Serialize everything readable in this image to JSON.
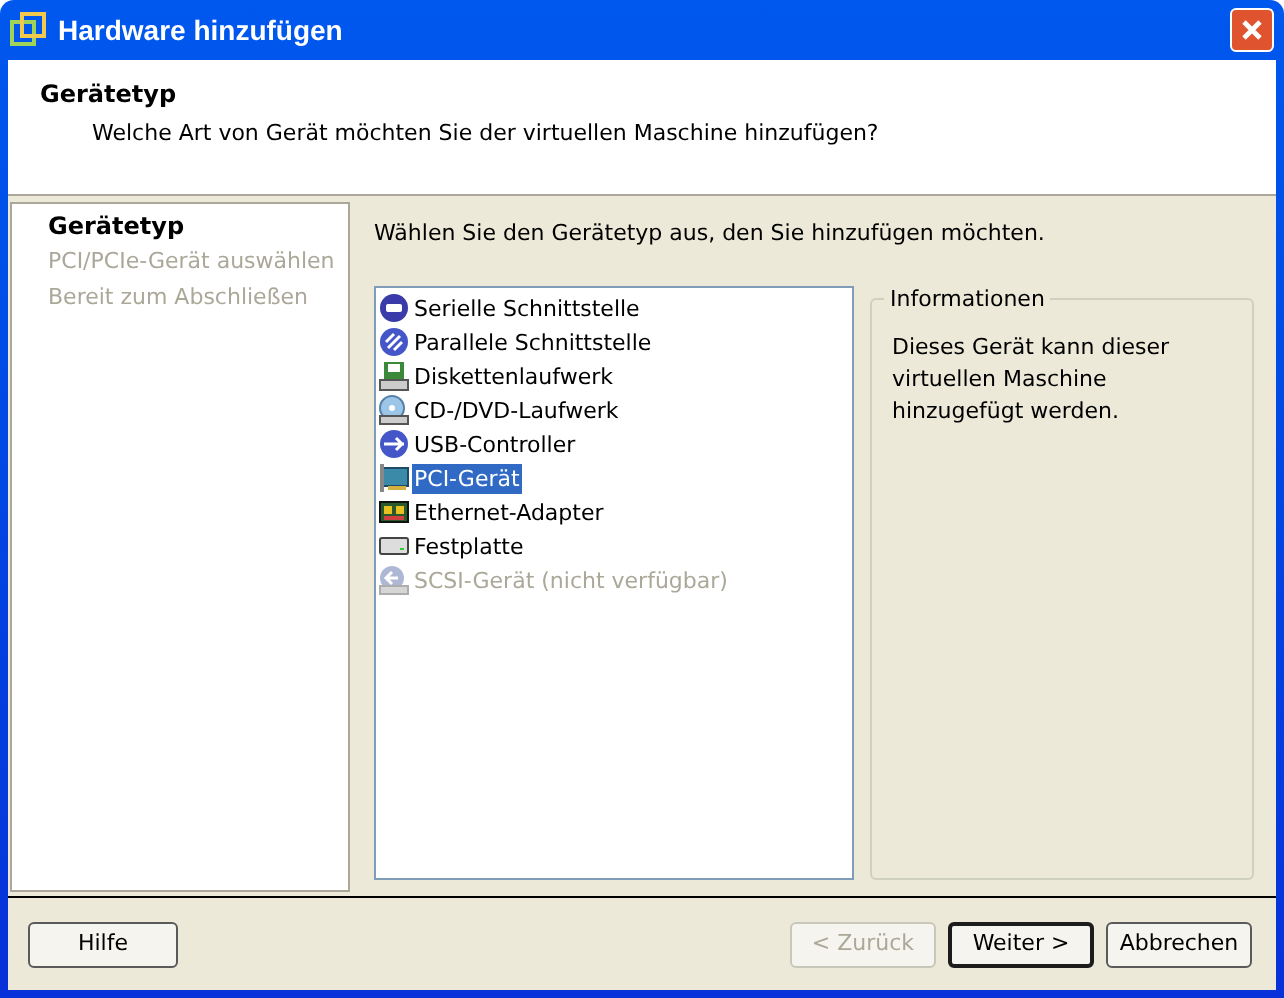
{
  "window": {
    "title": "Hardware hinzufügen"
  },
  "header": {
    "title": "Gerätetyp",
    "subtitle": "Welche Art von Gerät möchten Sie der virtuellen Maschine hinzufügen?"
  },
  "steps": [
    {
      "label": "Gerätetyp",
      "selected": true
    },
    {
      "label": "PCI/PCIe-Gerät auswählen",
      "selected": false
    },
    {
      "label": "Bereit zum Abschließen",
      "selected": false
    }
  ],
  "instruction": "Wählen Sie den Gerätetyp aus, den Sie hinzufügen möchten.",
  "devices": [
    {
      "label": "Serielle Schnittstelle",
      "kind": "serial",
      "selected": false,
      "disabled": false
    },
    {
      "label": "Parallele Schnittstelle",
      "kind": "parallel",
      "selected": false,
      "disabled": false
    },
    {
      "label": "Diskettenlaufwerk",
      "kind": "floppy",
      "selected": false,
      "disabled": false
    },
    {
      "label": "CD-/DVD-Laufwerk",
      "kind": "cdrom",
      "selected": false,
      "disabled": false
    },
    {
      "label": "USB-Controller",
      "kind": "usb",
      "selected": false,
      "disabled": false
    },
    {
      "label": "PCI-Gerät",
      "kind": "pci",
      "selected": true,
      "disabled": false
    },
    {
      "label": "Ethernet-Adapter",
      "kind": "ethernet",
      "selected": false,
      "disabled": false
    },
    {
      "label": "Festplatte",
      "kind": "disk",
      "selected": false,
      "disabled": false
    },
    {
      "label": "SCSI-Gerät (nicht verfügbar)",
      "kind": "scsi",
      "selected": false,
      "disabled": true
    }
  ],
  "info": {
    "title": "Informationen",
    "text": "Dieses Gerät kann dieser virtuellen Maschine hinzugefügt werden."
  },
  "buttons": [
    {
      "label": "Hilfe",
      "kind": "help",
      "disabled": false,
      "default": false
    },
    {
      "label": "< Zurück",
      "kind": "nav",
      "disabled": true,
      "default": false
    },
    {
      "label": "Weiter >",
      "kind": "nav",
      "disabled": false,
      "default": true
    },
    {
      "label": "Abbrechen",
      "kind": "nav",
      "disabled": false,
      "default": false
    }
  ]
}
